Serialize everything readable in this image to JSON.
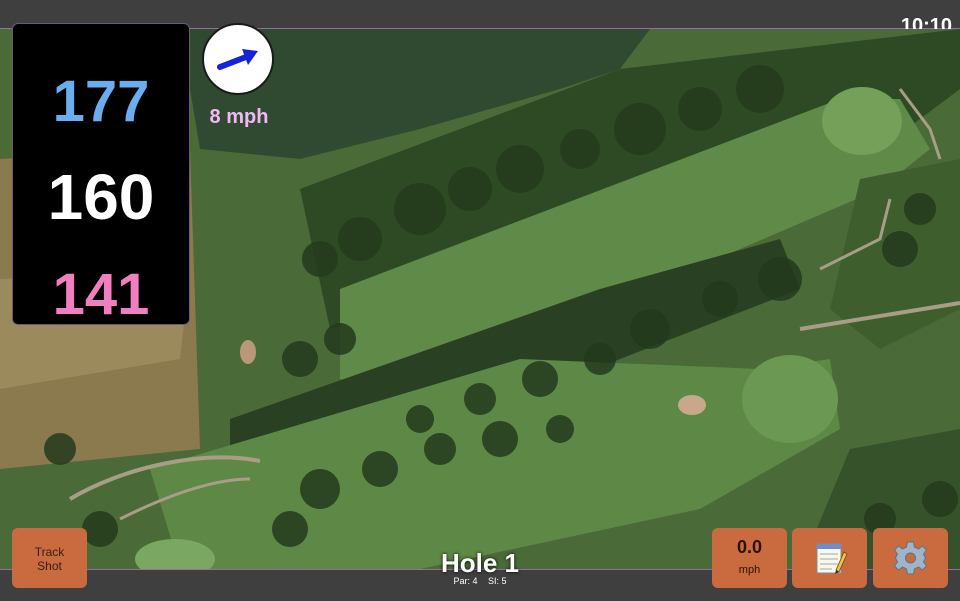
{
  "status_bar": {
    "time": "10:10"
  },
  "distances": {
    "back": "177",
    "middle": "160",
    "front": "141",
    "colors": {
      "back": "#6aaef0",
      "middle": "#ffffff",
      "front": "#f07fbf"
    }
  },
  "wind": {
    "speed_label": "8 mph",
    "arrow_icon": "arrow-icon",
    "arrow_color": "#1422d8",
    "speed_color": "#f2b8f5"
  },
  "hole": {
    "title": "Hole 1",
    "par": "Par: 4",
    "stroke_index": "SI: 5"
  },
  "buttons": {
    "track_shot_line1": "Track",
    "track_shot_line2": "Shot",
    "wind_value": "0.0",
    "wind_unit": "mph",
    "notes_icon": "notepad-icon",
    "settings_icon": "gear-icon",
    "color": "#c96b3e"
  }
}
